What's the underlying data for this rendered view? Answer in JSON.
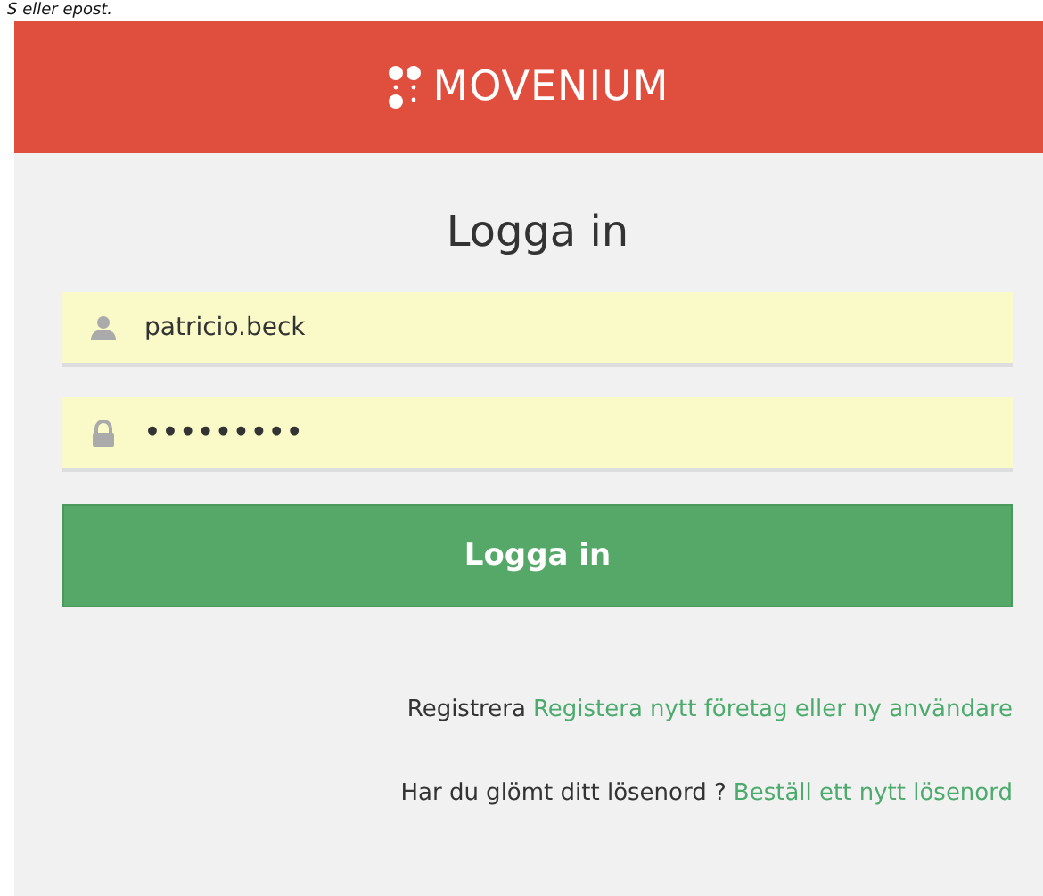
{
  "caption": "S eller epost.",
  "header": {
    "logo_text": "MOVENIUM"
  },
  "title": "Logga in",
  "fields": [
    {
      "kind": "user",
      "value": "patricio.beck"
    },
    {
      "kind": "password",
      "value": "•••••••••"
    }
  ],
  "submit_button": "Logga in",
  "links": [
    {
      "text": "Registrera",
      "link": "Registera nytt företag eller ny användare"
    },
    {
      "text": "Har du glömt ditt lösenord ?",
      "link": "Beställ ett nytt lösenord"
    }
  ]
}
